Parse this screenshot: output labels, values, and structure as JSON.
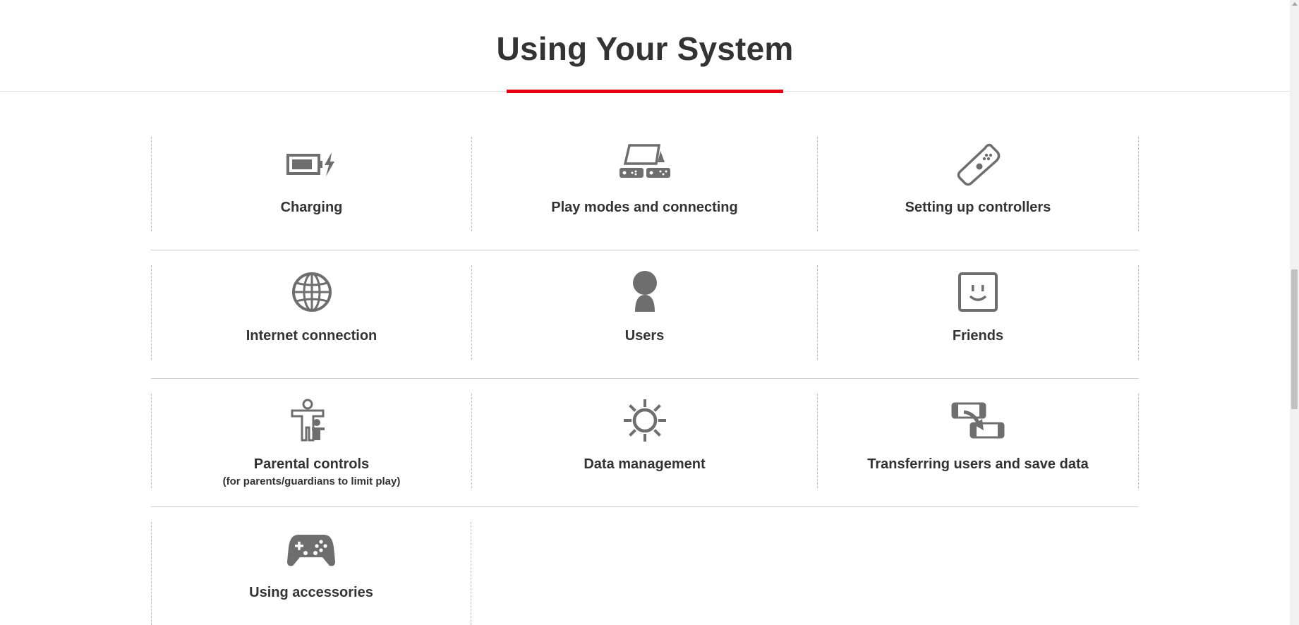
{
  "header": {
    "title": "Using Your System",
    "accent_color": "#e60012"
  },
  "topics": [
    {
      "label": "Charging",
      "sublabel": "",
      "icon": "battery-charging-icon"
    },
    {
      "label": "Play modes and connecting",
      "sublabel": "",
      "icon": "play-modes-icon"
    },
    {
      "label": "Setting up controllers",
      "sublabel": "",
      "icon": "joy-con-icon"
    },
    {
      "label": "Internet connection",
      "sublabel": "",
      "icon": "globe-icon"
    },
    {
      "label": "Users",
      "sublabel": "",
      "icon": "user-icon"
    },
    {
      "label": "Friends",
      "sublabel": "",
      "icon": "smiley-face-icon"
    },
    {
      "label": "Parental controls",
      "sublabel": "(for parents/guardians to limit play)",
      "icon": "parent-child-icon"
    },
    {
      "label": "Data management",
      "sublabel": "",
      "icon": "gear-sun-icon"
    },
    {
      "label": "Transferring users and save data",
      "sublabel": "",
      "icon": "console-transfer-icon"
    },
    {
      "label": "Using accessories",
      "sublabel": "",
      "icon": "gamepad-icon"
    }
  ],
  "icon_color": "#6e6e6e"
}
